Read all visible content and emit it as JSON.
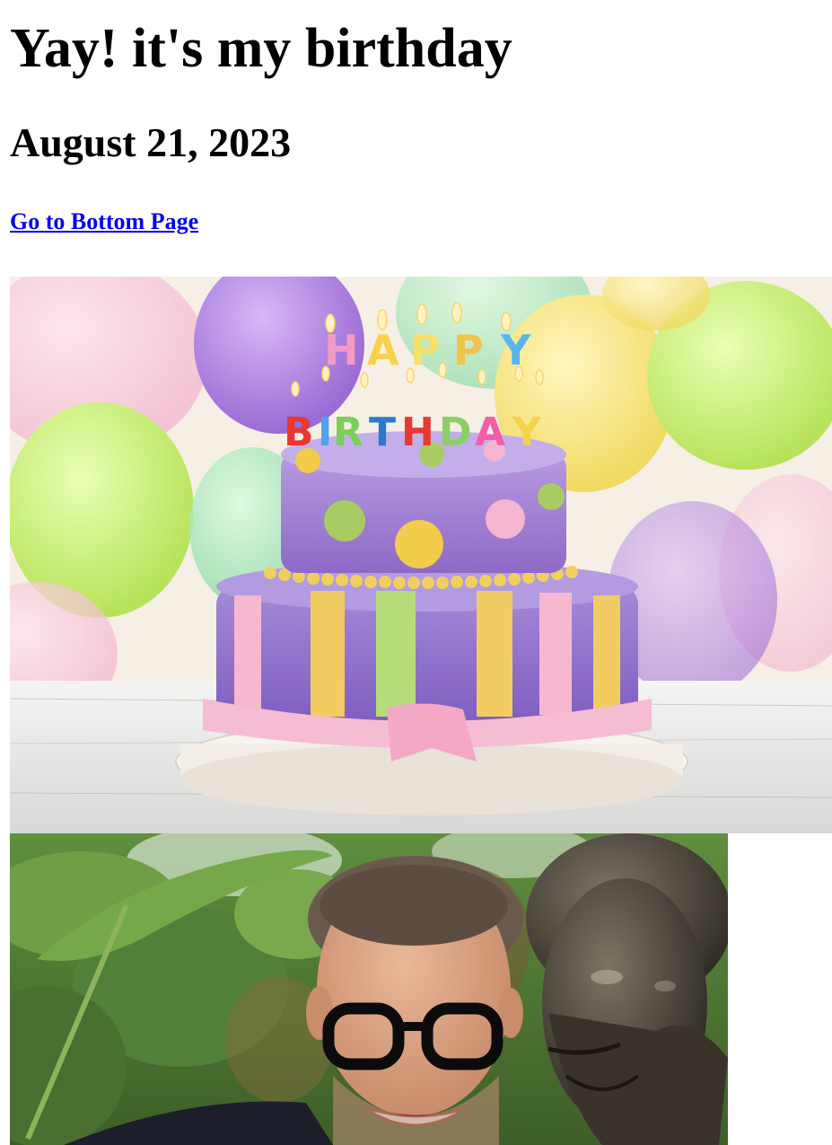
{
  "header": {
    "title": "Yay! it's my birthday",
    "date": "August 21, 2023"
  },
  "nav": {
    "bottom_link_label": "Go to Bottom Page"
  },
  "images": {
    "cake": {
      "candle_text_top": "HAPPY",
      "candle_text_bottom": "BIRTHDAY"
    },
    "portrait": {}
  },
  "colors": {
    "link": "#0000ee",
    "text": "#000000",
    "background": "#ffffff"
  }
}
